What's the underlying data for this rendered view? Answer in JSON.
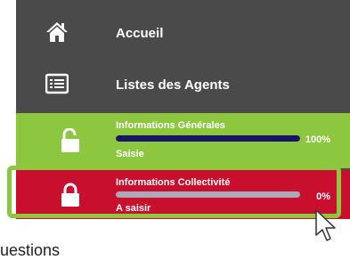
{
  "nav": {
    "home_label": "Accueil",
    "home_icon": "home-icon",
    "agents_label": "Listes des Agents",
    "agents_icon": "list-icon"
  },
  "cards": {
    "general": {
      "title": "Informations Générales",
      "percent_text": "100%",
      "progress": 1.0,
      "status": "Saisie",
      "icon": "unlocked-padlock-icon",
      "color": "#8dc63f"
    },
    "collectivite": {
      "title": "Informations Collectivité",
      "percent_text": "0%",
      "progress": 0.0,
      "status": "A saisir",
      "icon": "locked-padlock-icon",
      "color": "#c8102e"
    }
  },
  "colors": {
    "menu_bg": "#4a4a4a",
    "progress_fill": "#1a1464",
    "progress_track": "#a9a9b8",
    "highlight": "#8dc63f"
  },
  "partial_text": "uestions"
}
